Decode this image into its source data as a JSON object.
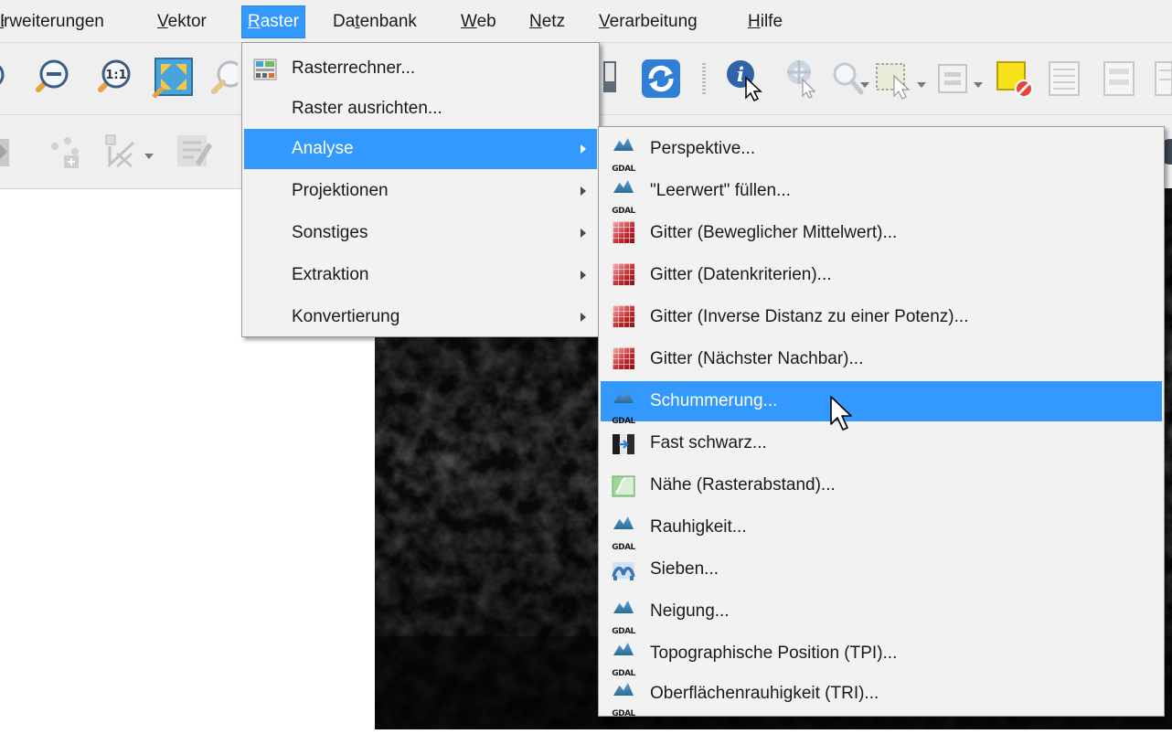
{
  "menubar": {
    "items": [
      {
        "pre": "",
        "ul": "",
        "post": "rweiterungen",
        "lead": "E"
      },
      {
        "pre": "",
        "ul": "V",
        "post": "ektor"
      },
      {
        "pre": "",
        "ul": "R",
        "post": "aster"
      },
      {
        "pre": "Da",
        "ul": "t",
        "post": "enbank"
      },
      {
        "pre": "",
        "ul": "W",
        "post": "eb"
      },
      {
        "pre": "",
        "ul": "N",
        "post": "etz"
      },
      {
        "pre": "",
        "ul": "V",
        "post": "erarbeitung"
      },
      {
        "pre": "",
        "ul": "H",
        "post": "ilfe"
      }
    ],
    "active_index": 2
  },
  "raster_menu": {
    "items": [
      {
        "label": "Rasterrechner...",
        "icon": "raster-calculator-icon"
      },
      {
        "label": "Raster ausrichten...",
        "icon": ""
      },
      {
        "label": "Analyse",
        "icon": "",
        "submenu": true
      },
      {
        "label": "Projektionen",
        "icon": "",
        "submenu": true
      },
      {
        "label": "Sonstiges",
        "icon": "",
        "submenu": true
      },
      {
        "label": "Extraktion",
        "icon": "",
        "submenu": true
      },
      {
        "label": "Konvertierung",
        "icon": "",
        "submenu": true
      }
    ],
    "highlighted_index": 2
  },
  "analyse_menu": {
    "items": [
      {
        "label": "Perspektive...",
        "icon": "gdal-icon"
      },
      {
        "label": "\"Leerwert\" füllen...",
        "icon": "gdal-icon"
      },
      {
        "label": "Gitter (Beweglicher Mittelwert)...",
        "icon": "grid-icon"
      },
      {
        "label": "Gitter (Datenkriterien)...",
        "icon": "grid-icon"
      },
      {
        "label": "Gitter (Inverse Distanz zu einer Potenz)...",
        "icon": "grid-icon"
      },
      {
        "label": "Gitter (Nächster Nachbar)...",
        "icon": "grid-icon"
      },
      {
        "label": "Schummerung...",
        "icon": "gdal-icon"
      },
      {
        "label": "Fast schwarz...",
        "icon": "nearblack-icon"
      },
      {
        "label": "Nähe (Rasterabstand)...",
        "icon": "proximity-icon"
      },
      {
        "label": "Rauhigkeit...",
        "icon": "gdal-icon"
      },
      {
        "label": "Sieben...",
        "icon": "sieve-icon"
      },
      {
        "label": "Neigung...",
        "icon": "gdal-icon"
      },
      {
        "label": "Topographische Position (TPI)...",
        "icon": "gdal-icon"
      },
      {
        "label": "Oberflächenrauhigkeit (TRI)...",
        "icon": "gdal-icon"
      }
    ],
    "highlighted_index": 6
  },
  "icons": {
    "gdal_text": "GDAL",
    "zoom_native_text": "1:1"
  },
  "colors": {
    "highlight": "#3399ff",
    "menu_bg": "#f2f2f2",
    "toolbar_bg": "#efefef",
    "raster_dark": "#0b0b0b"
  }
}
